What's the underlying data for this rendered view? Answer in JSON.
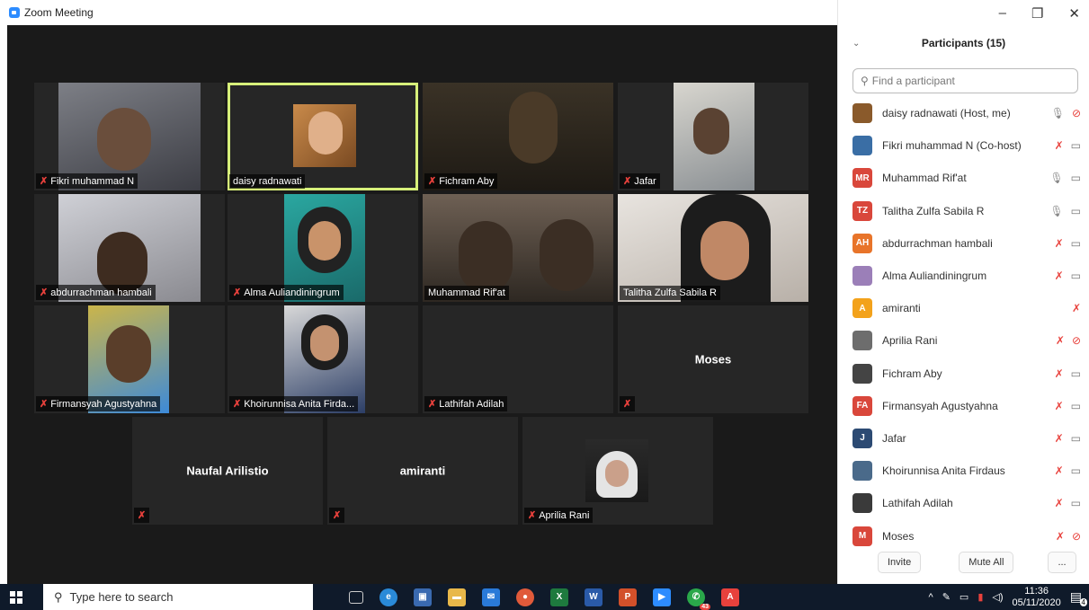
{
  "window": {
    "title": "Zoom Meeting"
  },
  "colors": {
    "active_border": "#d7f07a",
    "muted": "#e8413c",
    "zoom_blue": "#2d8cff"
  },
  "tiles": [
    {
      "name": "Fikri muhammad N",
      "muted": true
    },
    {
      "name": "daisy radnawati",
      "muted": false
    },
    {
      "name": "Fichram Aby",
      "muted": true
    },
    {
      "name": "Jafar",
      "muted": true
    },
    {
      "name": "abdurrachman hambali",
      "muted": true
    },
    {
      "name": "Alma Auliandiningrum",
      "muted": true
    },
    {
      "name": "Muhammad Rif'at",
      "muted": false
    },
    {
      "name": "Talitha Zulfa Sabila R",
      "muted": false
    },
    {
      "name": "Firmansyah Agustyahna",
      "muted": true
    },
    {
      "name": "Khoirunnisa Anita Firda...",
      "muted": true
    },
    {
      "name": "Lathifah Adilah",
      "muted": true
    },
    {
      "name": "Moses",
      "muted": true
    },
    {
      "name": "Naufal Arilistio",
      "muted": true
    },
    {
      "name": "amiranti",
      "muted": true
    },
    {
      "name": "Aprilia Rani",
      "muted": true
    }
  ],
  "panel": {
    "title": "Participants (15)",
    "search_placeholder": "Find a participant",
    "participants": [
      {
        "name": "daisy radnawati (Host, me)",
        "initials": "",
        "color": "#8a5a2b",
        "mic": "on",
        "cam": "off"
      },
      {
        "name": "Fikri muhammad N (Co-host)",
        "initials": "",
        "color": "#3a6ea5",
        "mic": "off",
        "cam": "on"
      },
      {
        "name": "Muhammad Rif'at",
        "initials": "MR",
        "color": "#d9473b",
        "mic": "on",
        "cam": "on"
      },
      {
        "name": "Talitha Zulfa Sabila R",
        "initials": "TZ",
        "color": "#d9473b",
        "mic": "on",
        "cam": "on"
      },
      {
        "name": "abdurrachman hambali",
        "initials": "AH",
        "color": "#e8742a",
        "mic": "off",
        "cam": "on"
      },
      {
        "name": "Alma Auliandiningrum",
        "initials": "",
        "color": "#9b7fb8",
        "mic": "off",
        "cam": "on"
      },
      {
        "name": "amiranti",
        "initials": "A",
        "color": "#f3a21b",
        "mic": "off",
        "cam": "none"
      },
      {
        "name": "Aprilia Rani",
        "initials": "",
        "color": "#6d6d6d",
        "mic": "off",
        "cam": "off"
      },
      {
        "name": "Fichram Aby",
        "initials": "",
        "color": "#444444",
        "mic": "off",
        "cam": "on"
      },
      {
        "name": "Firmansyah Agustyahna",
        "initials": "FA",
        "color": "#d9473b",
        "mic": "off",
        "cam": "on"
      },
      {
        "name": "Jafar",
        "initials": "J",
        "color": "#2c4a73",
        "mic": "off",
        "cam": "on"
      },
      {
        "name": "Khoirunnisa Anita Firdaus",
        "initials": "",
        "color": "#4a6a8a",
        "mic": "off",
        "cam": "on"
      },
      {
        "name": "Lathifah Adilah",
        "initials": "",
        "color": "#3a3a3a",
        "mic": "off",
        "cam": "on"
      },
      {
        "name": "Moses",
        "initials": "M",
        "color": "#d9473b",
        "mic": "off",
        "cam": "off"
      }
    ],
    "invite_label": "Invite",
    "mute_all_label": "Mute All",
    "more_label": "..."
  },
  "taskbar": {
    "search_placeholder": "Type here to search",
    "time": "11:36",
    "date": "05/11/2020",
    "notification_count": "4",
    "whatsapp_badge": "43"
  }
}
